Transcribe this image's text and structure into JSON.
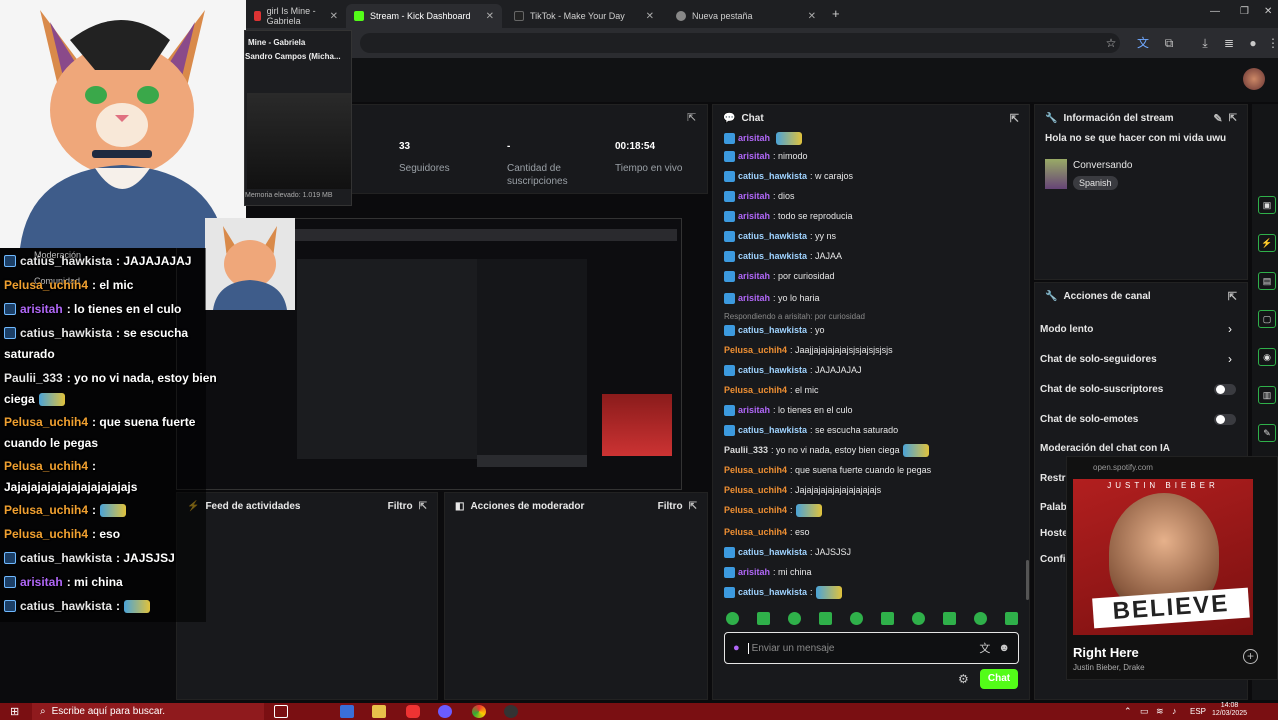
{
  "tabs": [
    {
      "title": "girl Is Mine - Gabriela",
      "color": "#d33"
    },
    {
      "title": "Stream - Kick Dashboard",
      "color": "#53fc18"
    },
    {
      "title": "TikTok - Make Your Day",
      "color": "#111"
    },
    {
      "title": "Nueva pestaña",
      "color": "#888"
    }
  ],
  "media_popup": {
    "line1": "Mine - Gabriela",
    "line2": "Sandro Campos (Micha...",
    "memory": "Memoria elevado: 1.019 MB"
  },
  "stats": [
    {
      "value": "33",
      "label": "Seguidores"
    },
    {
      "value": "-",
      "label": "Cantidad de suscripciones"
    },
    {
      "value": "00:18:54",
      "label": "Tiempo en vivo"
    }
  ],
  "chat": {
    "title": "Chat",
    "reply_note": "Respondiendo a arisitah: por curiosidad",
    "input_placeholder": "Enviar un mensaje",
    "send_label": "Chat",
    "messages": [
      {
        "user": "arisitah",
        "text": "",
        "color": "purple",
        "badge": true,
        "emote": true
      },
      {
        "user": "arisitah",
        "text": ": nimodo",
        "color": "purple",
        "badge": true
      },
      {
        "user": "catius_hawkista",
        "text": ": w carajos",
        "color": "blue",
        "badge": true
      },
      {
        "user": "arisitah",
        "text": ": dios",
        "color": "purple",
        "badge": true
      },
      {
        "user": "arisitah",
        "text": ": todo se reproducia",
        "color": "purple",
        "badge": true
      },
      {
        "user": "catius_hawkista",
        "text": ": yy ns",
        "color": "blue",
        "badge": true
      },
      {
        "user": "catius_hawkista",
        "text": ": JAJAA",
        "color": "blue",
        "badge": true
      },
      {
        "user": "arisitah",
        "text": ": por curiosidad",
        "color": "purple",
        "badge": true
      },
      {
        "user": "arisitah",
        "text": ": yo lo haria",
        "color": "purple",
        "badge": true
      },
      {
        "user": "catius_hawkista",
        "text": ": yo",
        "color": "blue",
        "badge": true
      },
      {
        "user": "Pelusa_uchih4",
        "text": ": Jaajjajajajajajsjsjajsjsjsjs",
        "color": "orange",
        "badge": false
      },
      {
        "user": "catius_hawkista",
        "text": ": JAJAJAJAJ",
        "color": "blue",
        "badge": true
      },
      {
        "user": "Pelusa_uchih4",
        "text": ": el mic",
        "color": "orange",
        "badge": false
      },
      {
        "user": "arisitah",
        "text": ": lo tienes en el culo",
        "color": "purple",
        "badge": true
      },
      {
        "user": "catius_hawkista",
        "text": ": se escucha saturado",
        "color": "blue",
        "badge": true
      },
      {
        "user": "Paulii_333",
        "text": ": yo no vi nada, estoy bien ciega",
        "color": "white",
        "badge": false,
        "emote": true
      },
      {
        "user": "Pelusa_uchih4",
        "text": ": que suena fuerte cuando le pegas",
        "color": "orange",
        "badge": false
      },
      {
        "user": "Pelusa_uchih4",
        "text": ": Jajajajajajajajajajajajs",
        "color": "orange",
        "badge": false
      },
      {
        "user": "Pelusa_uchih4",
        "text": ":",
        "color": "orange",
        "badge": false,
        "emote": true
      },
      {
        "user": "Pelusa_uchih4",
        "text": ": eso",
        "color": "orange",
        "badge": false
      },
      {
        "user": "catius_hawkista",
        "text": ": JAJSJSJ",
        "color": "blue",
        "badge": true
      },
      {
        "user": "arisitah",
        "text": ": mi china",
        "color": "purple",
        "badge": true
      },
      {
        "user": "catius_hawkista",
        "text": ":",
        "color": "blue",
        "badge": true,
        "emote": true
      }
    ]
  },
  "overlay": {
    "header": "Moderación",
    "sub": "Comunidad",
    "messages": [
      {
        "user": "catius_hawkista",
        "text": ": JAJAJAJAJ",
        "color": "white",
        "badge": true
      },
      {
        "user": "Pelusa_uchih4",
        "text": ": el mic",
        "color": "orange",
        "badge": false
      },
      {
        "user": "arisitah",
        "text": ": lo tienes en el culo",
        "color": "purple",
        "badge": true
      },
      {
        "user": "catius_hawkista",
        "text": ": se escucha",
        "color": "white",
        "badge": true
      },
      {
        "user": "",
        "text": "saturado",
        "color": "white",
        "badge": false
      },
      {
        "user": "Paulii_333",
        "text": ": yo no vi nada, estoy bien",
        "color": "white",
        "badge": false
      },
      {
        "user": "",
        "text": "ciega",
        "color": "white",
        "badge": false,
        "emote": true
      },
      {
        "user": "Pelusa_uchih4",
        "text": ": que suena fuerte",
        "color": "orange",
        "badge": false
      },
      {
        "user": "",
        "text": "cuando le pegas",
        "color": "white",
        "badge": false
      },
      {
        "user": "Pelusa_uchih4",
        "text": ":",
        "color": "orange",
        "badge": false
      },
      {
        "user": "",
        "text": "Jajajajajajajajajajajajajs",
        "color": "white",
        "badge": false
      },
      {
        "user": "Pelusa_uchih4",
        "text": ":",
        "color": "orange",
        "badge": false,
        "emote": true
      },
      {
        "user": "Pelusa_uchih4",
        "text": ": eso",
        "color": "orange",
        "badge": false
      },
      {
        "user": "catius_hawkista",
        "text": ": JAJSJSJ",
        "color": "white",
        "badge": true
      },
      {
        "user": "arisitah",
        "text": ": mi china",
        "color": "purple",
        "badge": true
      },
      {
        "user": "catius_hawkista",
        "text": ":",
        "color": "white",
        "badge": true,
        "emote": true
      }
    ]
  },
  "stream_info": {
    "title": "Información del stream",
    "stream_title": "Hola no se que hacer con mi vida uwu",
    "category": "Conversando",
    "language": "Spanish"
  },
  "channel_actions": {
    "title": "Acciones de canal",
    "items": [
      "Modo lento",
      "Chat de solo-seguidores",
      "Chat de solo-suscriptores",
      "Chat de solo-emotes",
      "Moderación del chat con IA",
      "Restri",
      "Palabr",
      "Hoste",
      "Config"
    ]
  },
  "panels": {
    "activity_feed": "Feed de actividades",
    "mod_actions": "Acciones de moderador",
    "filter": "Filtro"
  },
  "spotify": {
    "source": "open.spotify.com",
    "album_text": "BELIEVE",
    "artist_header": "JUSTIN BIEBER",
    "track": "Right Here",
    "artists": "Justin Bieber, Drake"
  },
  "taskbar": {
    "search_placeholder": "Escribe aquí para buscar.",
    "lang": "ESP",
    "time": "14:08",
    "date": "12/03/2025"
  },
  "colors": {
    "kick_green": "#53fc18",
    "taskbar_red": "#7a0f12"
  }
}
